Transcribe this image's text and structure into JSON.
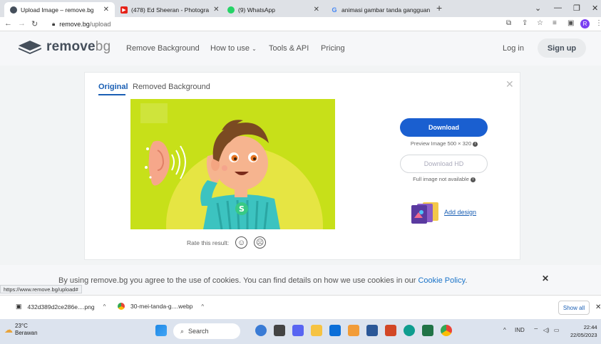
{
  "browser": {
    "tabs": [
      {
        "title": "Upload Image – remove.bg",
        "icon": "removebg-icon"
      },
      {
        "title": "(478) Ed Sheeran - Photogra",
        "icon": "youtube-icon"
      },
      {
        "title": "(9) WhatsApp",
        "icon": "whatsapp-icon"
      },
      {
        "title": "animasi gambar tanda gangguan",
        "icon": "google-icon"
      }
    ],
    "address": {
      "domain": "remove.bg",
      "path": "/upload"
    },
    "profile_initial": "R"
  },
  "site": {
    "logo_word": "remove",
    "logo_suffix": "bg",
    "nav": [
      "Remove Background",
      "How to use",
      "Tools & API",
      "Pricing"
    ],
    "login": "Log in",
    "signup": "Sign up"
  },
  "editor": {
    "tabs": [
      "Original",
      "Removed Background"
    ],
    "active_tab": "Original",
    "rate_label": "Rate this result:",
    "download": "Download",
    "preview_info": "Preview Image 500 × 320",
    "download_hd": "Download HD",
    "hd_info": "Full image not available",
    "add_design": "Add design"
  },
  "cookie": {
    "text": "By using remove.bg you agree to the use of cookies. You can find details on how we use cookies in our ",
    "link": "Cookie Policy",
    "end": "."
  },
  "status_url": "https://www.remove.bg/upload#",
  "downloads": {
    "items": [
      "432d389d2ce286e....png",
      "30-mei-tanda-g....webp"
    ],
    "show_all": "Show all"
  },
  "taskbar": {
    "temp": "23°C",
    "weather": "Berawan",
    "search": "Search",
    "lang": "IND",
    "time": "22:44",
    "date": "22/05/2023"
  },
  "colors": {
    "accent": "#1a5fd0",
    "logo_text": "#454f5b",
    "preview_bg": "#c7e019"
  }
}
